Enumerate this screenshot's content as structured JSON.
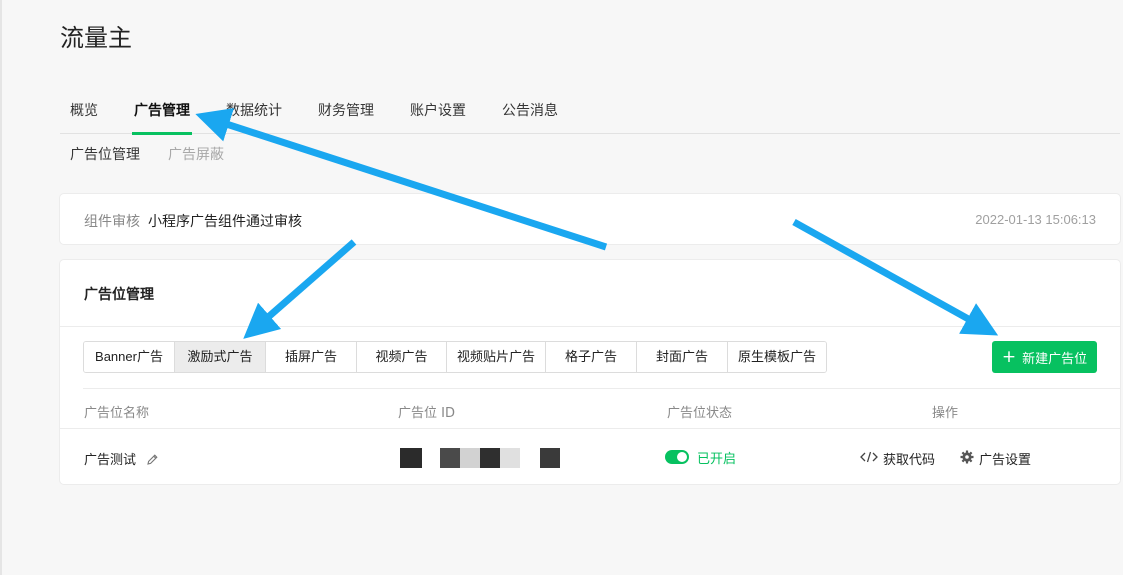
{
  "app": {
    "title": "流量主"
  },
  "main_tabs": [
    {
      "label": "概览"
    },
    {
      "label": "广告管理"
    },
    {
      "label": "数据统计"
    },
    {
      "label": "财务管理"
    },
    {
      "label": "账户设置"
    },
    {
      "label": "公告消息"
    }
  ],
  "sub_tabs": [
    {
      "label": "广告位管理"
    },
    {
      "label": "广告屏蔽"
    }
  ],
  "notice": {
    "label": "组件审核",
    "text": "小程序广告组件通过审核",
    "time": "2022-01-13 15:06:13"
  },
  "panel": {
    "title": "广告位管理",
    "ad_types": [
      {
        "label": "Banner广告"
      },
      {
        "label": "激励式广告"
      },
      {
        "label": "插屏广告"
      },
      {
        "label": "视频广告"
      },
      {
        "label": "视频贴片广告"
      },
      {
        "label": "格子广告"
      },
      {
        "label": "封面广告"
      },
      {
        "label": "原生模板广告"
      }
    ],
    "selected_type": "激励式广告",
    "new_button": "新建广告位",
    "columns": [
      "广告位名称",
      "广告位 ID",
      "广告位状态",
      "操作"
    ],
    "rows": [
      {
        "name": "广告测试",
        "status": "已开启",
        "actions": [
          "获取代码",
          "广告设置"
        ]
      }
    ]
  },
  "colors": {
    "accent": "#07c160",
    "annotation_arrow": "#1aa7f0"
  },
  "icons": {
    "plus": "plus-icon",
    "pencil": "pencil-icon",
    "code": "code-icon",
    "gear": "gear-icon"
  }
}
